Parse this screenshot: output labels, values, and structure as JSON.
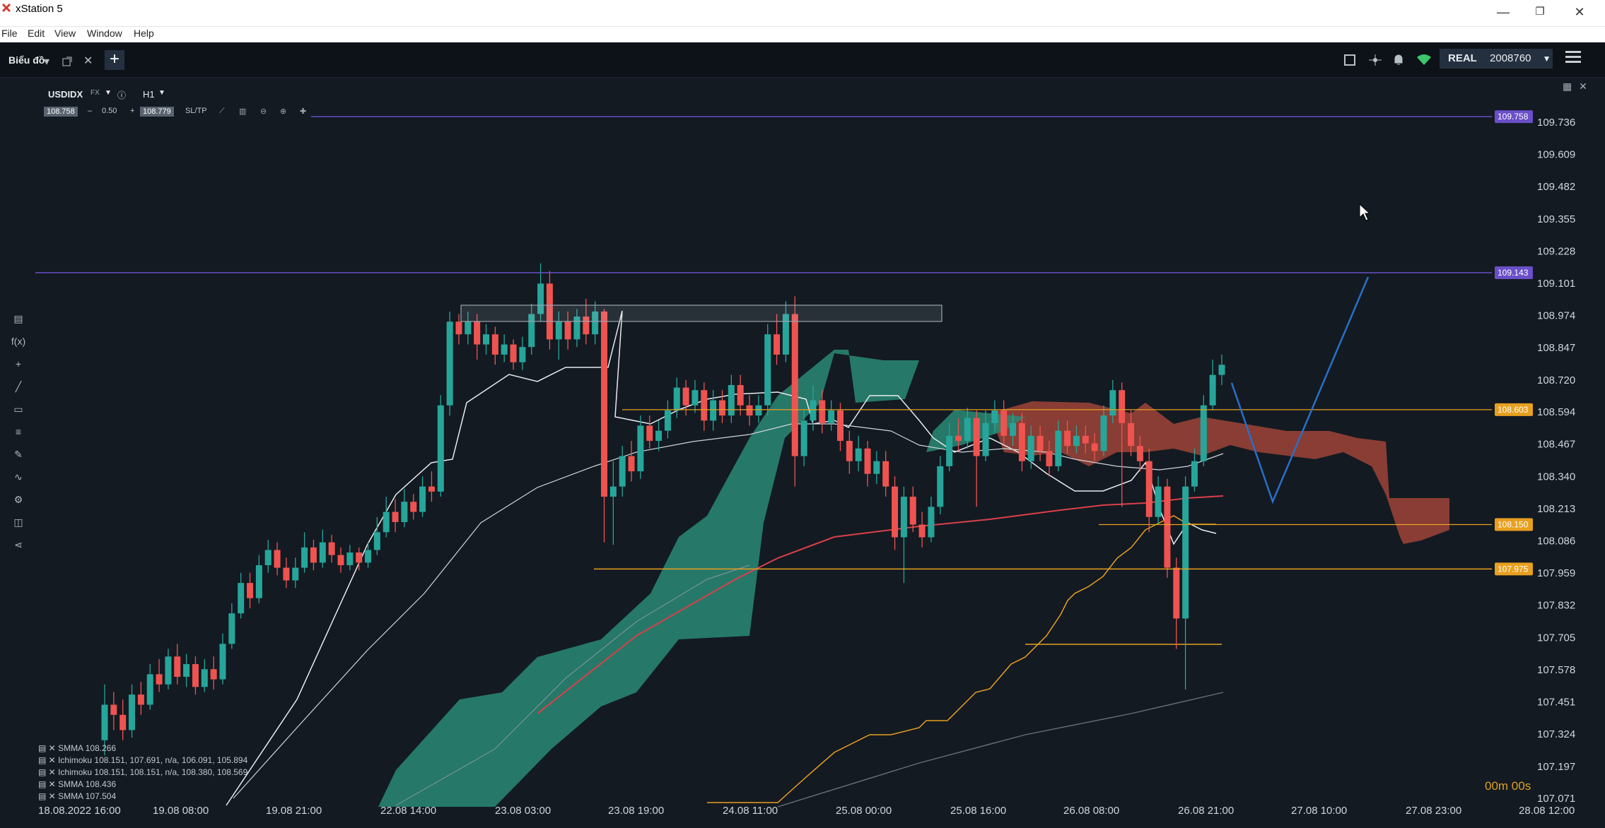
{
  "window": {
    "title": "xStation 5",
    "minimize": "—",
    "restore": "❐",
    "close": "✕"
  },
  "menu": [
    "File",
    "Edit",
    "View",
    "Window",
    "Help"
  ],
  "toolbar": {
    "tab_label": "Biểu đồ",
    "add_tab": "+",
    "account_type": "REAL",
    "account_number": "2008760"
  },
  "chart_header": {
    "symbol": "USDIDX",
    "market": "FX",
    "timeframe": "H1",
    "bid": "108.758",
    "spread": "0.50",
    "ask": "108.779",
    "sltp": "SL/TP"
  },
  "price_axis": [
    "109.736",
    "109.609",
    "109.482",
    "109.355",
    "109.228",
    "109.101",
    "108.974",
    "108.847",
    "108.720",
    "108.594",
    "108.467",
    "108.340",
    "108.213",
    "108.086",
    "107.959",
    "107.832",
    "107.705",
    "107.578",
    "107.451",
    "107.324",
    "107.197",
    "107.071"
  ],
  "price_tags": [
    {
      "value": "109.758",
      "color": "#6a4fc8"
    },
    {
      "value": "109.143",
      "color": "#6a4fc8"
    },
    {
      "value": "108.603",
      "color": "#e8a020"
    },
    {
      "value": "108.150",
      "color": "#e8a020"
    },
    {
      "value": "107.975",
      "color": "#e8a020"
    }
  ],
  "time_axis": [
    "18.08.2022 16:00",
    "19.08 08:00",
    "19.08 21:00",
    "22.08 14:00",
    "23.08 03:00",
    "23.08 19:00",
    "24.08 11:00",
    "25.08 00:00",
    "25.08 16:00",
    "26.08 08:00",
    "26.08 21:00",
    "27.08 10:00",
    "27.08 23:00",
    "28.08 12:00"
  ],
  "legend": [
    "SMMA 108.266",
    "Ichimoku 108.151, 107.691, n/a, 106.091, 105.894",
    "Ichimoku 108.151, 108.151, n/a, 108.380, 108.569",
    "SMMA 108.436",
    "SMMA 107.504"
  ],
  "countdown": "00m 00s",
  "colors": {
    "bull": "#26a69a",
    "bear": "#ef5350",
    "cloud_bull": "#2a8a74",
    "cloud_bear": "#a8463a",
    "level": "#e8a020",
    "resistance": "#6a4fc8",
    "projection": "#2a6fc8"
  },
  "icons": [
    "xstation-logo-icon",
    "popout-icon",
    "close-tab-icon",
    "layout-icon",
    "network-icon",
    "bell-icon",
    "wifi-icon",
    "chevron-down-icon",
    "menu-icon",
    "info-icon",
    "zoom-in-icon",
    "zoom-out-icon",
    "crosshair-icon"
  ]
}
